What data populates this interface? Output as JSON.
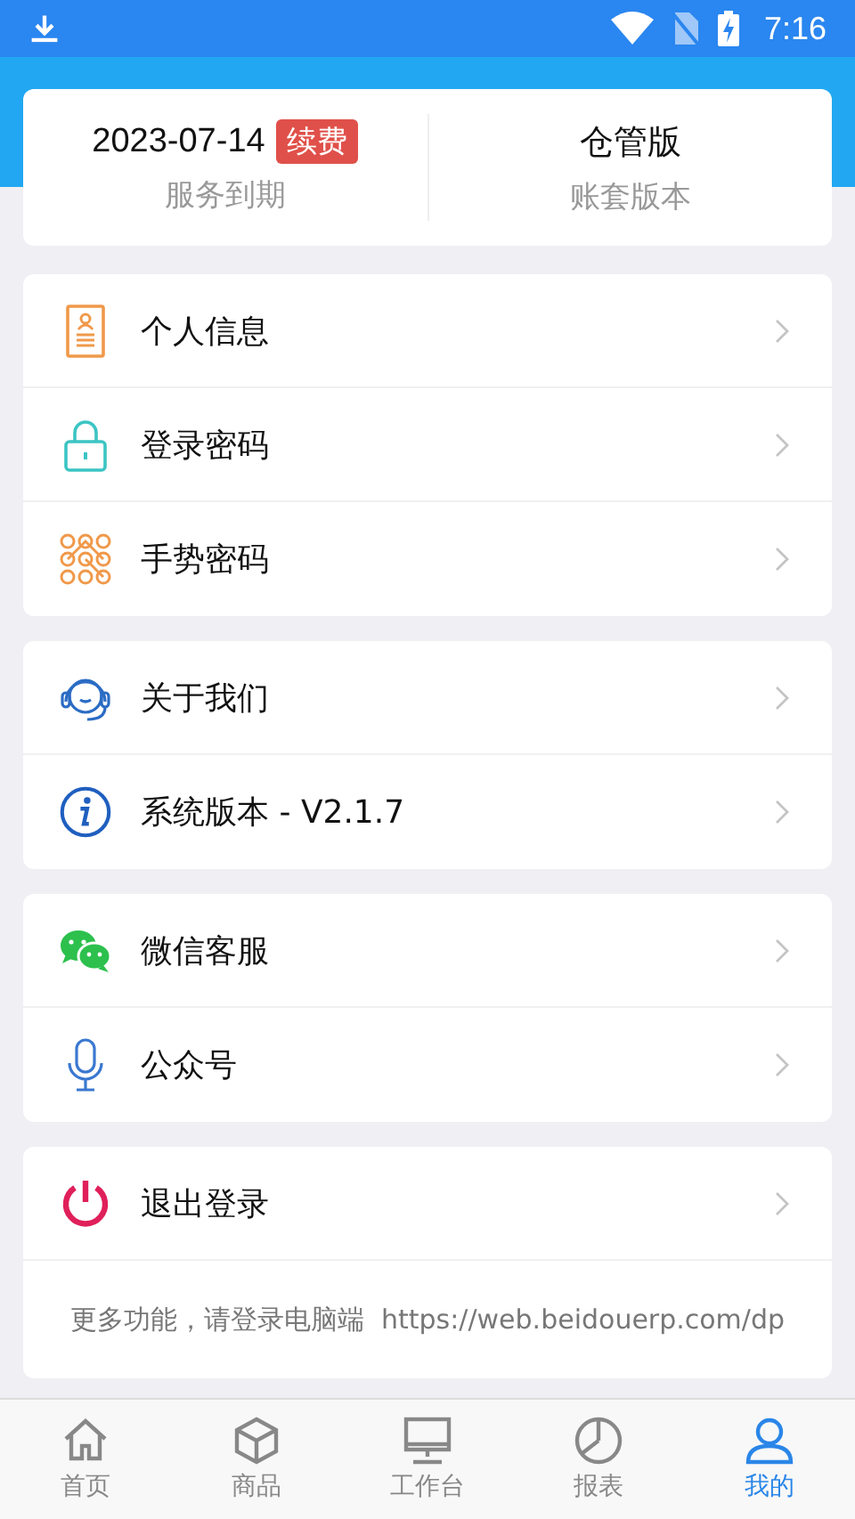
{
  "status_bar": {
    "time": "7:16"
  },
  "account": {
    "expiry_date": "2023-07-14",
    "renew_badge": "续费",
    "expiry_label": "服务到期",
    "edition": "仓管版",
    "edition_label": "账套版本"
  },
  "menu_groups": [
    {
      "items": [
        {
          "kind": "profile",
          "label": "个人信息"
        },
        {
          "kind": "lock",
          "label": "登录密码"
        },
        {
          "kind": "pattern",
          "label": "手势密码"
        }
      ]
    },
    {
      "items": [
        {
          "kind": "support",
          "label": "关于我们"
        },
        {
          "kind": "info",
          "label": "系统版本 - V2.1.7"
        }
      ]
    },
    {
      "items": [
        {
          "kind": "wechat",
          "label": "微信客服"
        },
        {
          "kind": "mic",
          "label": "公众号"
        }
      ]
    },
    {
      "items": [
        {
          "kind": "power",
          "label": "退出登录"
        }
      ],
      "note": "更多功能，请登录电脑端  https://web.beidouerp.com/dp"
    }
  ],
  "tab_bar": [
    {
      "kind": "home",
      "label": "首页",
      "selected": false
    },
    {
      "kind": "box",
      "label": "商品",
      "selected": false
    },
    {
      "kind": "monitor",
      "label": "工作台",
      "selected": false
    },
    {
      "kind": "chart",
      "label": "报表",
      "selected": false
    },
    {
      "kind": "person",
      "label": "我的",
      "selected": true
    }
  ]
}
